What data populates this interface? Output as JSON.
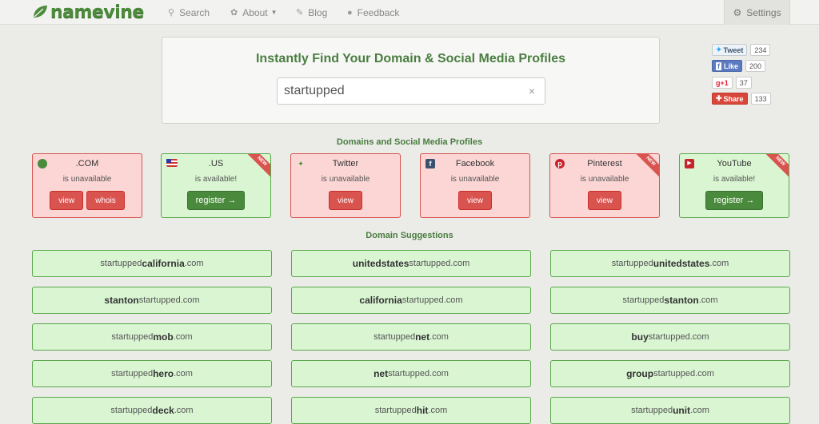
{
  "navbar": {
    "logo_text": "namevine",
    "search": "Search",
    "about": "About",
    "blog": "Blog",
    "feedback": "Feedback",
    "settings": "Settings"
  },
  "search": {
    "title": "Instantly Find Your Domain & Social Media Profiles",
    "value": "startupped",
    "clear_glyph": "×"
  },
  "share": {
    "tweet_label": "Tweet",
    "tweet_count": "234",
    "like_label": "Like",
    "like_count": "200",
    "gplus_label": "g+1",
    "gplus_count": "37",
    "share_label": "Share",
    "share_count": "133"
  },
  "profiles_title": "Domains and Social Media Profiles",
  "profiles": [
    {
      "name": ".COM",
      "status": "is unavailable",
      "available": false,
      "buttons": [
        "view",
        "whois"
      ],
      "icon": "globe-icon",
      "new": false
    },
    {
      "name": ".US",
      "status": "is available!",
      "available": true,
      "buttons": [
        "register →"
      ],
      "icon": "us-flag-icon",
      "new": true
    },
    {
      "name": "Twitter",
      "status": "is unavailable",
      "available": false,
      "buttons": [
        "view"
      ],
      "icon": "twitter-icon",
      "new": false
    },
    {
      "name": "Facebook",
      "status": "is unavailable",
      "available": false,
      "buttons": [
        "view"
      ],
      "icon": "facebook-icon",
      "new": false
    },
    {
      "name": "Pinterest",
      "status": "is unavailable",
      "available": false,
      "buttons": [
        "view"
      ],
      "icon": "pinterest-icon",
      "new": true
    },
    {
      "name": "YouTube",
      "status": "is available!",
      "available": true,
      "buttons": [
        "register →"
      ],
      "icon": "youtube-icon",
      "new": true
    }
  ],
  "new_badge": "NEW",
  "suggestions_title": "Domain Suggestions",
  "suggestions": [
    {
      "pre": "startupped",
      "bold": "california",
      "post": ".com"
    },
    {
      "pre": "",
      "bold": "unitedstates",
      "post": "startupped.com"
    },
    {
      "pre": "startupped",
      "bold": "unitedstates",
      "post": ".com"
    },
    {
      "pre": "",
      "bold": "stanton",
      "post": "startupped.com"
    },
    {
      "pre": "",
      "bold": "california",
      "post": "startupped.com"
    },
    {
      "pre": "startupped",
      "bold": "stanton",
      "post": ".com"
    },
    {
      "pre": "startupped",
      "bold": "mob",
      "post": ".com"
    },
    {
      "pre": "startupped",
      "bold": "net",
      "post": ".com"
    },
    {
      "pre": "",
      "bold": "buy",
      "post": "startupped.com"
    },
    {
      "pre": "startupped",
      "bold": "hero",
      "post": ".com"
    },
    {
      "pre": "",
      "bold": "net",
      "post": "startupped.com"
    },
    {
      "pre": "",
      "bold": "group",
      "post": "startupped.com"
    },
    {
      "pre": "startupped",
      "bold": "deck",
      "post": ".com"
    },
    {
      "pre": "startupped",
      "bold": "hit",
      "post": ".com"
    },
    {
      "pre": "startupped",
      "bold": "unit",
      "post": ".com"
    }
  ]
}
